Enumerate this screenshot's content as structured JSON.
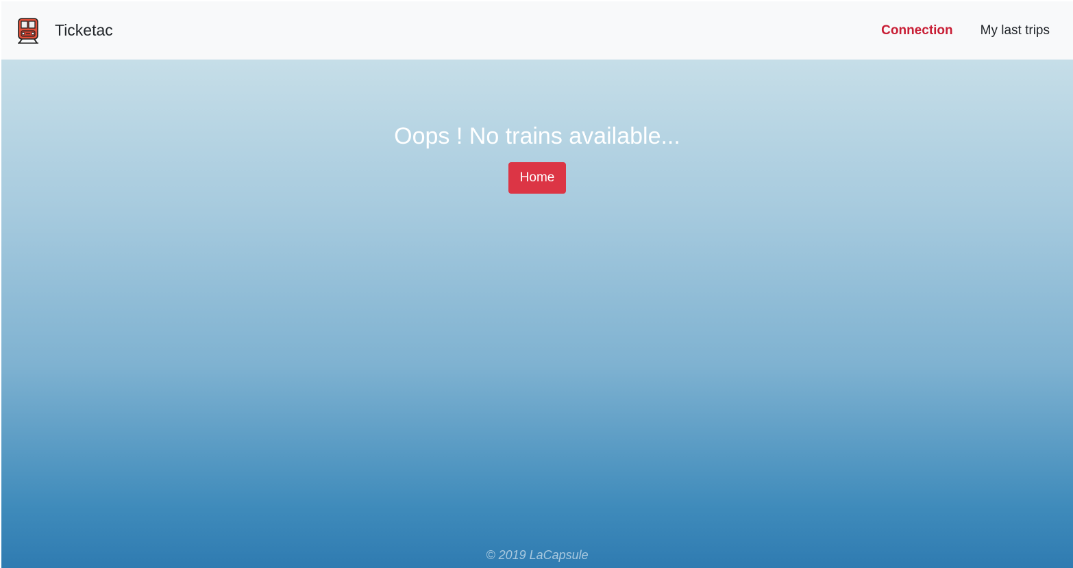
{
  "navbar": {
    "brand": {
      "icon": "train-icon",
      "name": "Ticketac"
    },
    "links": [
      {
        "label": "Connection",
        "active": true,
        "color": "#c81d34"
      },
      {
        "label": "My last trips",
        "active": false
      }
    ]
  },
  "main": {
    "title": "Oops ! No trains available...",
    "home_button_label": "Home",
    "button_color": "#dc3545"
  },
  "footer": {
    "text": "© 2019 LaCapsule"
  }
}
